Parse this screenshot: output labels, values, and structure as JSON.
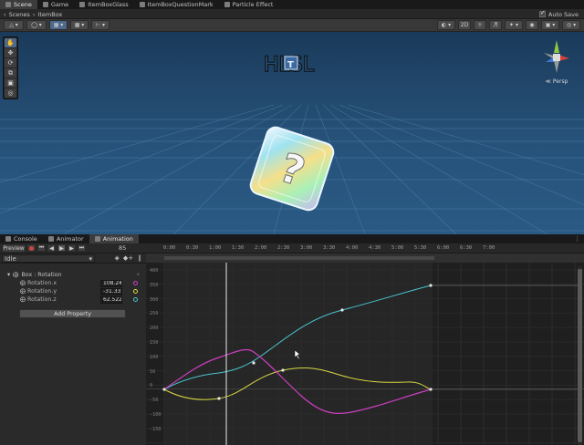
{
  "top_tabs": [
    {
      "label": "Scene",
      "icon": "scene-icon",
      "active": true
    },
    {
      "label": "Game",
      "icon": "game-icon",
      "active": false
    },
    {
      "label": "ItemBoxGlass",
      "icon": "shader-icon",
      "active": false
    },
    {
      "label": "ItemBoxQuestionMark",
      "icon": "shader-icon",
      "active": false
    },
    {
      "label": "Particle Effect",
      "icon": "particle-icon",
      "active": false
    }
  ],
  "breadcrumb": {
    "scenes": "Scenes",
    "item": "ItemBox"
  },
  "auto_save": {
    "label": "Auto Save",
    "checked": true
  },
  "scene": {
    "persp_label": "Persp",
    "gizmo_axes": {
      "x": "x",
      "y": "y",
      "z": "z"
    }
  },
  "panel_tabs": [
    {
      "label": "Console",
      "icon": "console-icon"
    },
    {
      "label": "Animator",
      "icon": "animator-icon"
    },
    {
      "label": "Animation",
      "icon": "animation-icon",
      "active": true
    }
  ],
  "anim_toolbar": {
    "preview_label": "Preview",
    "frame": "85"
  },
  "clip": {
    "name": "Idle"
  },
  "properties": {
    "group_label": "Box : Rotation",
    "rows": [
      {
        "label": "Rotation.x",
        "value": "108.24",
        "color": "#cc3fbf"
      },
      {
        "label": "Rotation.y",
        "value": "-31.335",
        "color": "#d9d944"
      },
      {
        "label": "Rotation.z",
        "value": "62.522",
        "color": "#49c4d1"
      }
    ]
  },
  "add_property_label": "Add Property",
  "timeline": {
    "ticks": [
      "0:00",
      "0:30",
      "1:00",
      "1:30",
      "2:00",
      "2:30",
      "3:00",
      "3:30",
      "4:00",
      "4:30",
      "5:00",
      "5:30",
      "6:00",
      "6:30",
      "7:00"
    ]
  },
  "curves": {
    "y_labels": [
      "400",
      "350",
      "300",
      "250",
      "200",
      "150",
      "100",
      "50",
      "0",
      "-50",
      "-100",
      "-150"
    ],
    "colors": {
      "x": "#cc3fbf",
      "y": "#d9d944",
      "z": "#49c4d1"
    }
  }
}
